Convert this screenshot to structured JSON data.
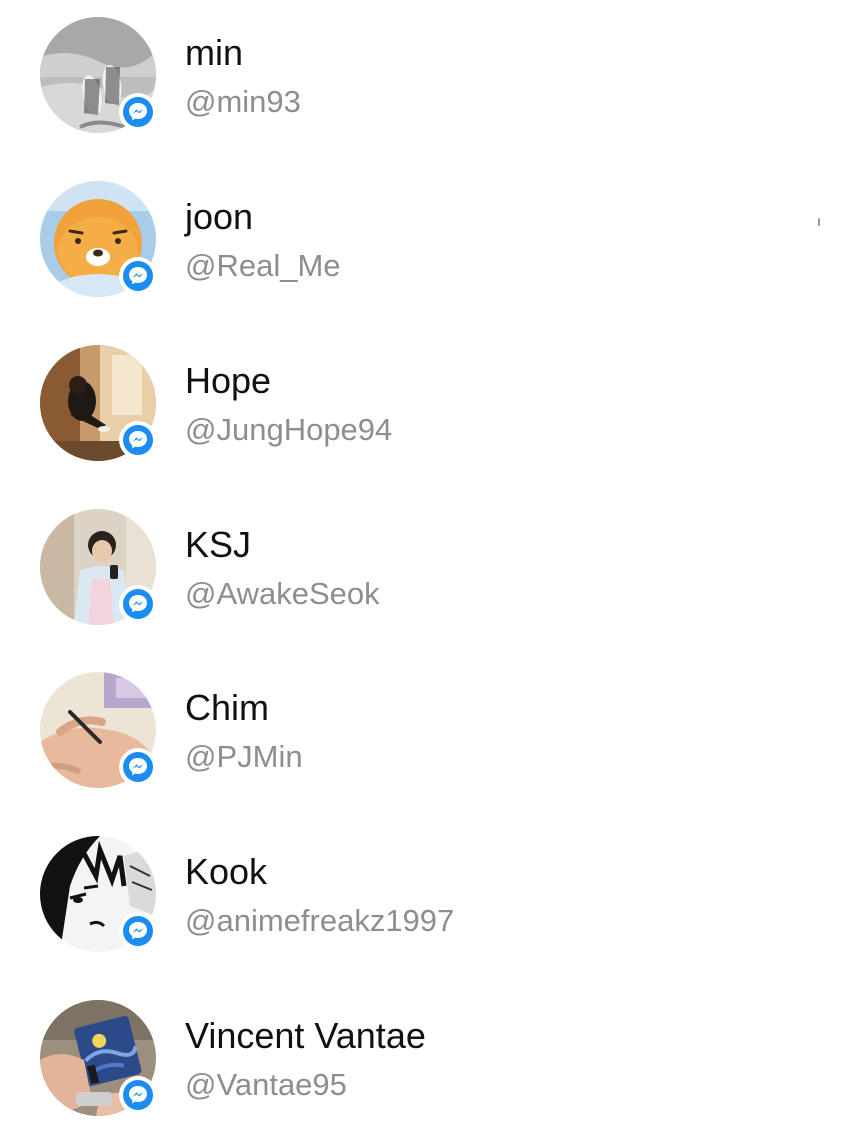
{
  "contacts": [
    {
      "name": "min",
      "handle": "@min93",
      "avatar_icon": "feet-photo-avatar"
    },
    {
      "name": "joon",
      "handle": "@Real_Me",
      "avatar_icon": "yellow-bear-character-avatar"
    },
    {
      "name": "Hope",
      "handle": "@JungHope94",
      "avatar_icon": "person-sitting-photo-avatar"
    },
    {
      "name": "KSJ",
      "handle": "@AwakeSeok",
      "avatar_icon": "mirror-selfie-photo-avatar"
    },
    {
      "name": "Chim",
      "handle": "@PJMin",
      "avatar_icon": "hand-holding-pen-photo-avatar"
    },
    {
      "name": "Kook",
      "handle": "@animefreakz1997",
      "avatar_icon": "anime-character-avatar"
    },
    {
      "name": "Vincent Vantae",
      "handle": "@Vantae95",
      "avatar_icon": "starry-night-card-photo-avatar"
    }
  ],
  "badge_icon": "messenger-icon",
  "colors": {
    "name_text": "#111111",
    "handle_text": "#8e8e8e",
    "messenger_blue": "#1b8cf2",
    "background": "#ffffff"
  }
}
